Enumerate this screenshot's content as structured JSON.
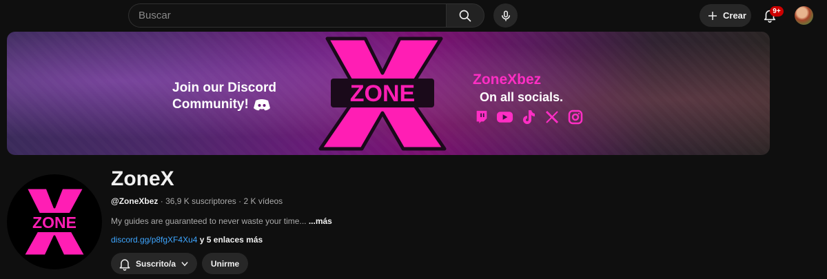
{
  "search": {
    "placeholder": "Buscar"
  },
  "header": {
    "create_label": "Crear",
    "notifications_badge": "9+"
  },
  "banner": {
    "left_line1": "Join our Discord",
    "left_line2": "Community!",
    "logo_text": "ZONE",
    "handle": "ZoneXbez",
    "tagline": "On all socials.",
    "social_icons": [
      "twitch-icon",
      "youtube-icon",
      "tiktok-icon",
      "x-icon",
      "instagram-icon"
    ]
  },
  "channel": {
    "name": "ZoneX",
    "handle": "@ZoneXbez",
    "subscribers": "36,9 K suscriptores",
    "videos": "2 K vídeos",
    "separator": "·",
    "description": "My guides are guaranteed to never waste your time...",
    "description_more": "...más",
    "link": "discord.gg/p8fgXF4Xu4",
    "more_links": "y 5 enlaces más",
    "subscribe_label": "Suscrito/a",
    "join_label": "Unirme",
    "avatar_logo_text": "ZONE"
  },
  "colors": {
    "accent_pink": "#ff2ec4",
    "background": "#0f0f0f",
    "button_bg": "#272727",
    "link_blue": "#3ea6ff",
    "badge_red": "#cc0000"
  }
}
